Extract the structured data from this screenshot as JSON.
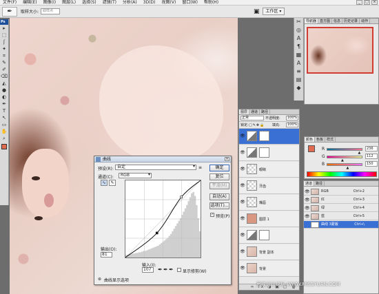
{
  "menubar": {
    "items": [
      "文件(F)",
      "编辑(E)",
      "图像(I)",
      "图层(L)",
      "选择(S)",
      "滤镜(T)",
      "分析(A)",
      "3D(D)",
      "视图(V)",
      "窗口(W)",
      "帮助(H)"
    ],
    "window_controls": [
      "_",
      "□",
      "×"
    ]
  },
  "options_bar": {
    "tool_icon": "eyedropper-icon",
    "sample_size_label": "取样大小:",
    "sample_size_value": "取样点",
    "workspace_label": "工作区 ▾"
  },
  "toolbox": {
    "logo": "Ps",
    "tools": [
      "▸",
      "⬚",
      "ʃ",
      "✦",
      "⌗",
      "✎",
      "✐",
      "⌫",
      "◭",
      "●",
      "◐",
      "✒",
      "T",
      "↖",
      "▭",
      "✋",
      "⌕"
    ],
    "foreground_color": "#e06a4f",
    "background_color": "#ffffff"
  },
  "curves_dialog": {
    "title": "曲线",
    "preset_label": "预设(R):",
    "preset_value": "自定",
    "channel_label": "通道(C):",
    "channel_value": "RGB",
    "output_label": "输出(O):",
    "output_value": "81",
    "input_label": "输入(I):",
    "input_value": "107",
    "show_clipping_label": "显示修剪(W)",
    "curve_display_options": "曲线显示选项",
    "buttons": {
      "ok": "确定",
      "cancel": "复位",
      "smooth": "平滑(M)",
      "auto": "自动(A)",
      "options": "选项(T)..."
    },
    "preview_label": "预览(P)",
    "preview_checked": true,
    "curve_points": [
      [
        0,
        0
      ],
      [
        107,
        81
      ],
      [
        190,
        200
      ],
      [
        255,
        255
      ]
    ],
    "histogram": [
      4,
      4,
      5,
      5,
      6,
      6,
      7,
      7,
      8,
      8,
      9,
      10,
      10,
      11,
      12,
      13,
      14,
      15,
      16,
      17,
      18,
      20,
      22,
      24,
      26,
      28,
      30,
      33,
      36,
      40,
      44,
      48,
      52,
      56,
      60,
      65,
      70,
      75,
      80,
      86,
      92,
      98,
      100,
      94,
      80,
      60,
      40
    ]
  },
  "mini_dock": {
    "icons": [
      "✂",
      "◎",
      "A",
      "¶",
      "▦",
      "A",
      "≡",
      "▤",
      "◆"
    ]
  },
  "navigator_panel": {
    "tabs": [
      "导航器",
      "直方图",
      "信息",
      "历史记录",
      "动作"
    ]
  },
  "layers_panel": {
    "tabs": [
      "图层",
      "通道",
      "路径"
    ],
    "blend_mode": "正常",
    "opacity_label": "不透明度:",
    "opacity_value": "100%",
    "lock_label": "锁定:",
    "fill_label": "填充:",
    "fill_value": "100%",
    "layers": [
      {
        "name": "",
        "thumb": "mask",
        "selected": true,
        "adjustment": true
      },
      {
        "name": "",
        "thumb": "mask",
        "selected": false,
        "adjustment": true
      },
      {
        "name": "眼睛",
        "thumb": "checker",
        "selected": false,
        "adjustment": false
      },
      {
        "name": "牙齿",
        "thumb": "checker",
        "selected": false,
        "adjustment": false
      },
      {
        "name": "嘴唇",
        "thumb": "checker",
        "selected": false,
        "adjustment": false
      },
      {
        "name": "图层 1",
        "thumb": "fill",
        "selected": false,
        "adjustment": false
      },
      {
        "name": "",
        "thumb": "mask",
        "selected": false,
        "adjustment": true
      },
      {
        "name": "背景 副本",
        "thumb": "photo",
        "selected": false,
        "adjustment": false
      },
      {
        "name": "背景",
        "thumb": "photo",
        "selected": false,
        "adjustment": false
      }
    ],
    "footer_icons": "∞ fx ◑ ▣ ▢ 🗑"
  },
  "color_panel": {
    "tabs": [
      "颜色",
      "色板",
      "样式"
    ],
    "labels": [
      "R",
      "G",
      "B"
    ],
    "values": [
      "236",
      "112",
      "150"
    ],
    "slider_fractions": [
      0.93,
      0.44,
      0.59
    ]
  },
  "channels_panel": {
    "tabs": [
      "通道",
      "路径"
    ],
    "channels": [
      {
        "name": "RGB",
        "shortcut": "Ctrl+2",
        "selected": false,
        "thumb": "photo"
      },
      {
        "name": "红",
        "shortcut": "Ctrl+3",
        "selected": false,
        "thumb": "photo"
      },
      {
        "name": "绿",
        "shortcut": "Ctrl+4",
        "selected": false,
        "thumb": "photo"
      },
      {
        "name": "蓝",
        "shortcut": "Ctrl+5",
        "selected": false,
        "thumb": "photo"
      },
      {
        "name": "曲线 3蒙版",
        "shortcut": "Ctrl+\\",
        "selected": true,
        "thumb": "white"
      }
    ]
  },
  "watermark": "思缘设计论坛 WWW.MISSYUAN.COM"
}
